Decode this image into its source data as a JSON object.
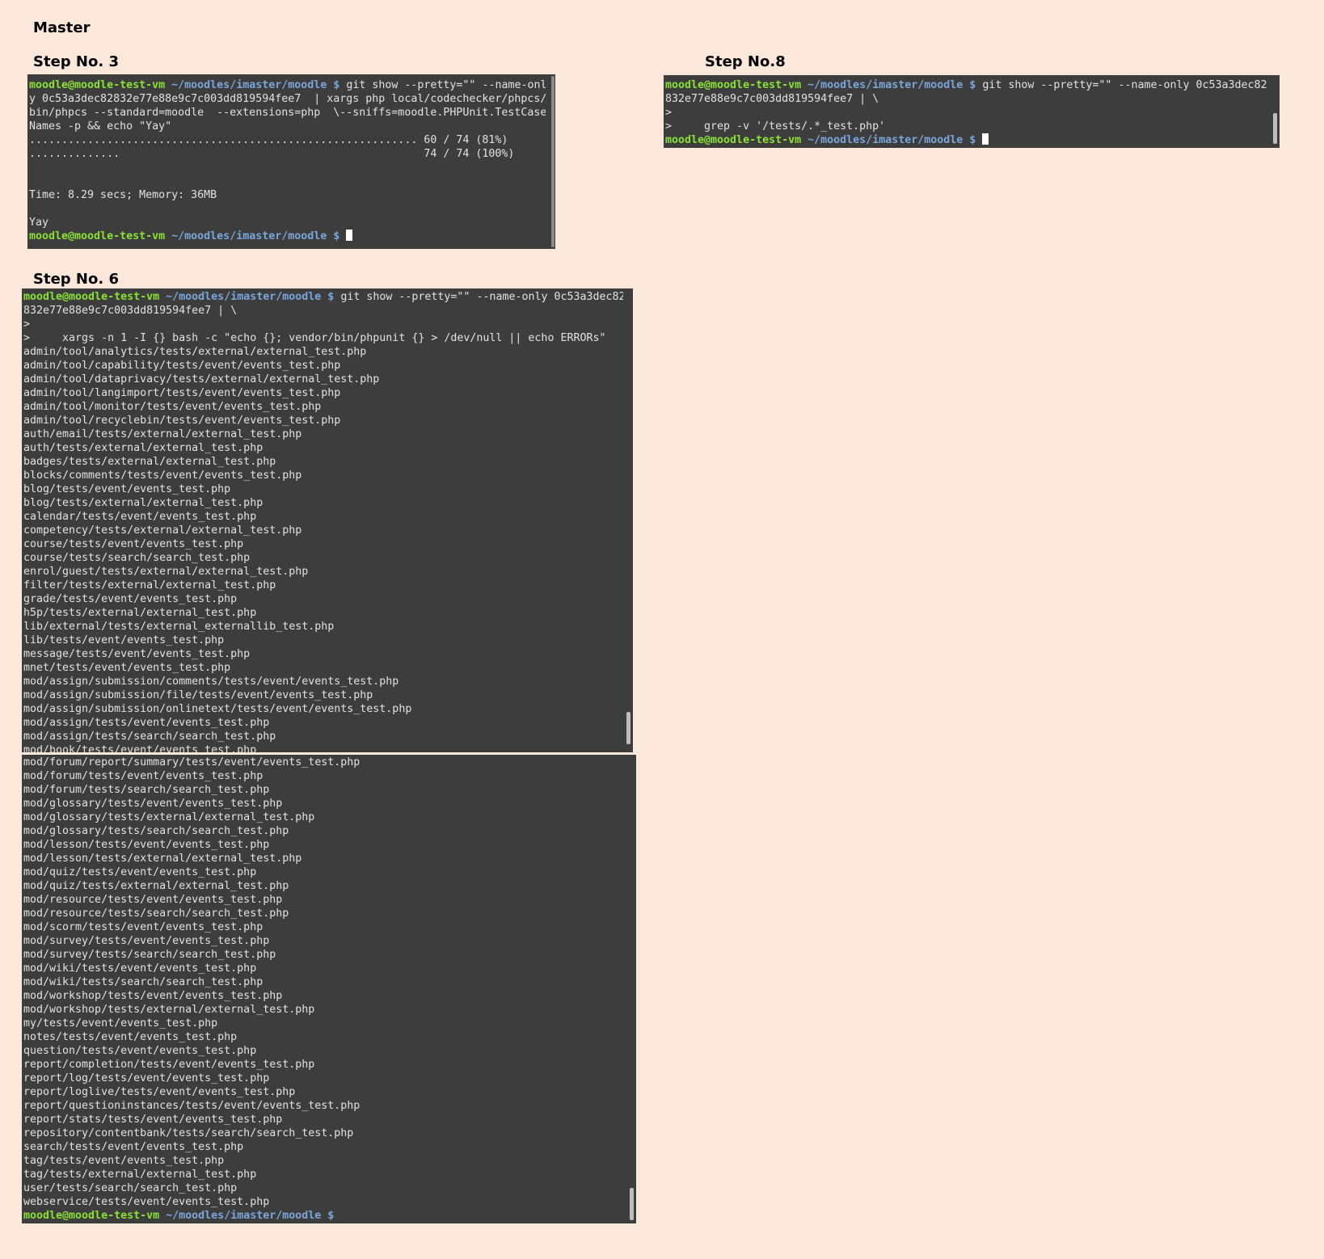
{
  "title": "Master",
  "colors": {
    "background": "#fce8da",
    "terminal_bg": "#3d3d3d",
    "terminal_text": "#e2e2e2",
    "prompt_user": "#8ae234",
    "prompt_path": "#7aa6da"
  },
  "prompt": {
    "user": "moodle@moodle-test-vm",
    "path": "~/moodles/imaster/moodle",
    "symbol": "$"
  },
  "step3": {
    "heading": "Step No. 3",
    "lines": [
      "y 0c53a3dec82832e77e88e9c7c003dd819594fee7  | xargs php local/codechecker/phpcs/",
      "bin/phpcs --standard=moodle  --extensions=php  \\--sniffs=moodle.PHPUnit.TestCase",
      "Names -p && echo \"Yay\"",
      "............................................................ 60 / 74 (81%)",
      "..............                                               74 / 74 (100%)",
      "",
      "",
      "Time: 8.29 secs; Memory: 36MB",
      "",
      "Yay"
    ],
    "command": "git show --pretty=\"\" --name-onl"
  },
  "step8": {
    "heading": "Step No.8",
    "command": "git show --pretty=\"\" --name-only 0c53a3dec82",
    "lines": [
      "832e77e88e9c7c003dd819594fee7 | \\",
      ">",
      ">     grep -v '/tests/.*_test.php'"
    ]
  },
  "step6": {
    "heading": "Step No. 6",
    "command": "git show --pretty=\"\" --name-only 0c53a3dec82",
    "lines_top": [
      "832e77e88e9c7c003dd819594fee7 | \\",
      ">",
      ">     xargs -n 1 -I {} bash -c \"echo {}; vendor/bin/phpunit {} > /dev/null || echo ERRORs\"",
      "admin/tool/analytics/tests/external/external_test.php",
      "admin/tool/capability/tests/event/events_test.php",
      "admin/tool/dataprivacy/tests/external/external_test.php",
      "admin/tool/langimport/tests/event/events_test.php",
      "admin/tool/monitor/tests/event/events_test.php",
      "admin/tool/recyclebin/tests/event/events_test.php",
      "auth/email/tests/external/external_test.php",
      "auth/tests/external/external_test.php",
      "badges/tests/external/external_test.php",
      "blocks/comments/tests/event/events_test.php",
      "blog/tests/event/events_test.php",
      "blog/tests/external/external_test.php",
      "calendar/tests/event/events_test.php",
      "competency/tests/external/external_test.php",
      "course/tests/event/events_test.php",
      "course/tests/search/search_test.php",
      "enrol/guest/tests/external/external_test.php",
      "filter/tests/external/external_test.php",
      "grade/tests/event/events_test.php",
      "h5p/tests/external/external_test.php",
      "lib/external/tests/external_externallib_test.php",
      "lib/tests/event/events_test.php",
      "message/tests/event/events_test.php",
      "mnet/tests/event/events_test.php",
      "mod/assign/submission/comments/tests/event/events_test.php",
      "mod/assign/submission/file/tests/event/events_test.php",
      "mod/assign/submission/onlinetext/tests/event/events_test.php",
      "mod/assign/tests/event/events_test.php",
      "mod/assign/tests/search/search_test.php",
      "mod/book/tests/event/events_test.php"
    ],
    "lines_bottom": [
      "mod/forum/report/summary/tests/event/events_test.php",
      "mod/forum/tests/event/events_test.php",
      "mod/forum/tests/search/search_test.php",
      "mod/glossary/tests/event/events_test.php",
      "mod/glossary/tests/external/external_test.php",
      "mod/glossary/tests/search/search_test.php",
      "mod/lesson/tests/event/events_test.php",
      "mod/lesson/tests/external/external_test.php",
      "mod/quiz/tests/event/events_test.php",
      "mod/quiz/tests/external/external_test.php",
      "mod/resource/tests/event/events_test.php",
      "mod/resource/tests/search/search_test.php",
      "mod/scorm/tests/event/events_test.php",
      "mod/survey/tests/event/events_test.php",
      "mod/survey/tests/search/search_test.php",
      "mod/wiki/tests/event/events_test.php",
      "mod/wiki/tests/search/search_test.php",
      "mod/workshop/tests/event/events_test.php",
      "mod/workshop/tests/external/external_test.php",
      "my/tests/event/events_test.php",
      "notes/tests/event/events_test.php",
      "question/tests/event/events_test.php",
      "report/completion/tests/event/events_test.php",
      "report/log/tests/event/events_test.php",
      "report/loglive/tests/event/events_test.php",
      "report/questioninstances/tests/event/events_test.php",
      "report/stats/tests/event/events_test.php",
      "repository/contentbank/tests/search/search_test.php",
      "search/tests/event/events_test.php",
      "tag/tests/event/events_test.php",
      "tag/tests/external/external_test.php",
      "user/tests/search/search_test.php",
      "webservice/tests/event/events_test.php"
    ]
  }
}
